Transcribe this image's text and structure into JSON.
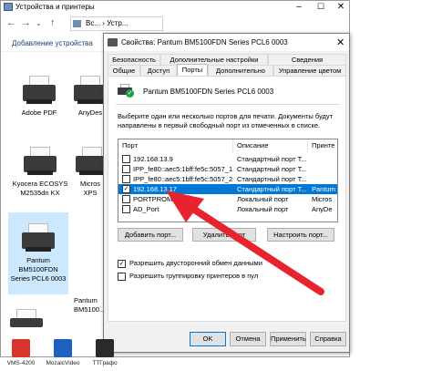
{
  "explorer": {
    "title": "Устройства и принтеры",
    "address": "Вс... › Устр...",
    "toolbar_add": "Добавление устройства",
    "devices": [
      {
        "label": "Adobe PDF"
      },
      {
        "label": "AnyDes"
      },
      {
        "label": "Kyocera ECOSYS M2535dn KX"
      },
      {
        "label": "Micros XPS"
      },
      {
        "label": "Pantum BM5100FDN Series PCL6 0003"
      },
      {
        "label": "Pantum BM5100..."
      }
    ]
  },
  "dialog": {
    "title": "Свойства: Pantum BM5100FDN Series PCL6 0003",
    "close_glyph": "✕",
    "tabs_top": [
      "Безопасность",
      "Дополнительные настройки",
      "Сведения"
    ],
    "tabs_bottom": [
      "Общие",
      "Доступ",
      "Порты",
      "Дополнительно",
      "Управление цветом"
    ],
    "printer_name": "Pantum BM5100FDN Series PCL6 0003",
    "instructions": "Выберите один или несколько портов для печати. Документы будут направлены в первый свободный порт из отмеченных в списке.",
    "columns": [
      "Порт",
      "Описание",
      "Принте"
    ],
    "ports": [
      {
        "checked": false,
        "port": "192.168.13.9",
        "desc": "Стандартный порт T...",
        "printer": ""
      },
      {
        "checked": false,
        "port": "IPP_fe80::aec5:1bff:fe5c:5057_1",
        "desc": "Стандартный порт T...",
        "printer": ""
      },
      {
        "checked": false,
        "port": "IPP_fe80::aec5:1bff:fe5c:5057_2",
        "desc": "Стандартный порт T...",
        "printer": ""
      },
      {
        "checked": true,
        "port": "192.168.13.17",
        "desc": "Стандартный порт T...",
        "printer": "Pantum",
        "selected": true
      },
      {
        "checked": false,
        "port": "PORTPROMPT:",
        "desc": "Локальный порт",
        "printer": "Micros"
      },
      {
        "checked": false,
        "port": "AD_Port",
        "desc": "Локальный порт",
        "printer": "AnyDe"
      }
    ],
    "btn_add": "Добавить порт...",
    "btn_delete": "Удалить порт",
    "btn_configure": "Настроить порт...",
    "chk_bidirectional": "Разрешить двусторонний обмен данными",
    "chk_bidirectional_checked": "✓",
    "chk_pooling": "Разрешить группировку принтеров в пул",
    "btn_ok": "OK",
    "btn_cancel": "Отмена",
    "btn_apply": "Применить",
    "btn_help": "Справка"
  },
  "taskbar": [
    {
      "label": "VMS-4200"
    },
    {
      "label": "MozaicVideo"
    },
    {
      "label": "ТТГрафо"
    }
  ],
  "colors": {
    "selection": "#0078d7",
    "arrow": "#e8232e",
    "status_ok": "#1aa34a"
  }
}
